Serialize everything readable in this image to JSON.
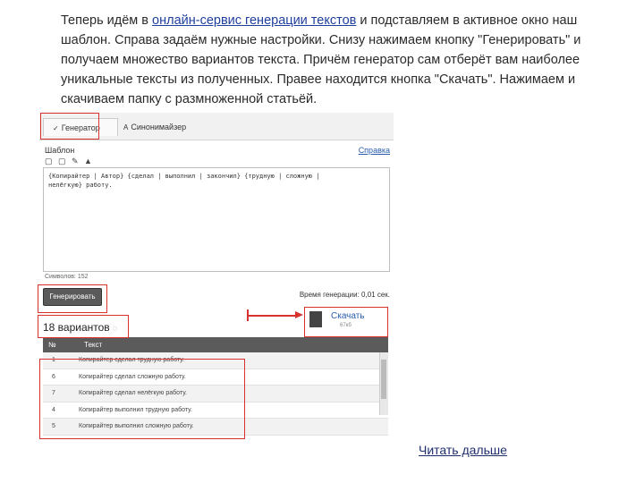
{
  "intro": {
    "prefix": "Теперь идём в ",
    "link": "онлайн-сервис генерации текстов",
    "suffix": " и подставляем в активное окно наш шаблон. Справа задаём нужные настройки. Снизу нажимаем кнопку \"Генерировать\" и получаем множество вариантов текста. Причём генератор сам отберёт вам наиболее уникальные тексты из полученных. Правее находится кнопка \"Скачать\". Нажимаем и скачиваем папку с размноженной статьёй."
  },
  "screenshot": {
    "tabs": [
      "Генератор",
      "Синонимайзер"
    ],
    "template_label": "Шаблон",
    "help_link": "Справка",
    "toolbar": "▢ ▢ ✎ ▲",
    "template_text": "{Копирайтер | Автор} {сделал | выполнил | закончил} {трудную | сложную |\nнелёгкую} работу.",
    "char_count": "Символов: 152",
    "generate_button": "Генерировать",
    "generation_time": "Время генерации: 0,01 сек.",
    "variants_label": "18 вариантов",
    "download_label": "Скачать",
    "download_size": "67кб",
    "table_headers": [
      "№",
      "Текст"
    ],
    "rows": [
      {
        "num": "1",
        "text": "Копирайтер сделал трудную работу."
      },
      {
        "num": "6",
        "text": "Копирайтер сделал сложную работу."
      },
      {
        "num": "7",
        "text": "Копирайтер сделал нелёгкую работу."
      },
      {
        "num": "4",
        "text": "Копирайтер выполнил трудную работу."
      },
      {
        "num": "5",
        "text": "Копирайтер выполнил сложную работу."
      }
    ]
  },
  "read_more": "Читать дальше",
  "colors": {
    "highlight": "#d9322e",
    "link": "#1f3f9e",
    "header": "#5b5b5b"
  },
  "icons": {
    "tab_generator": "check-icon",
    "tab_synonymizer": "letter-a-icon",
    "download": "archive-icon"
  }
}
